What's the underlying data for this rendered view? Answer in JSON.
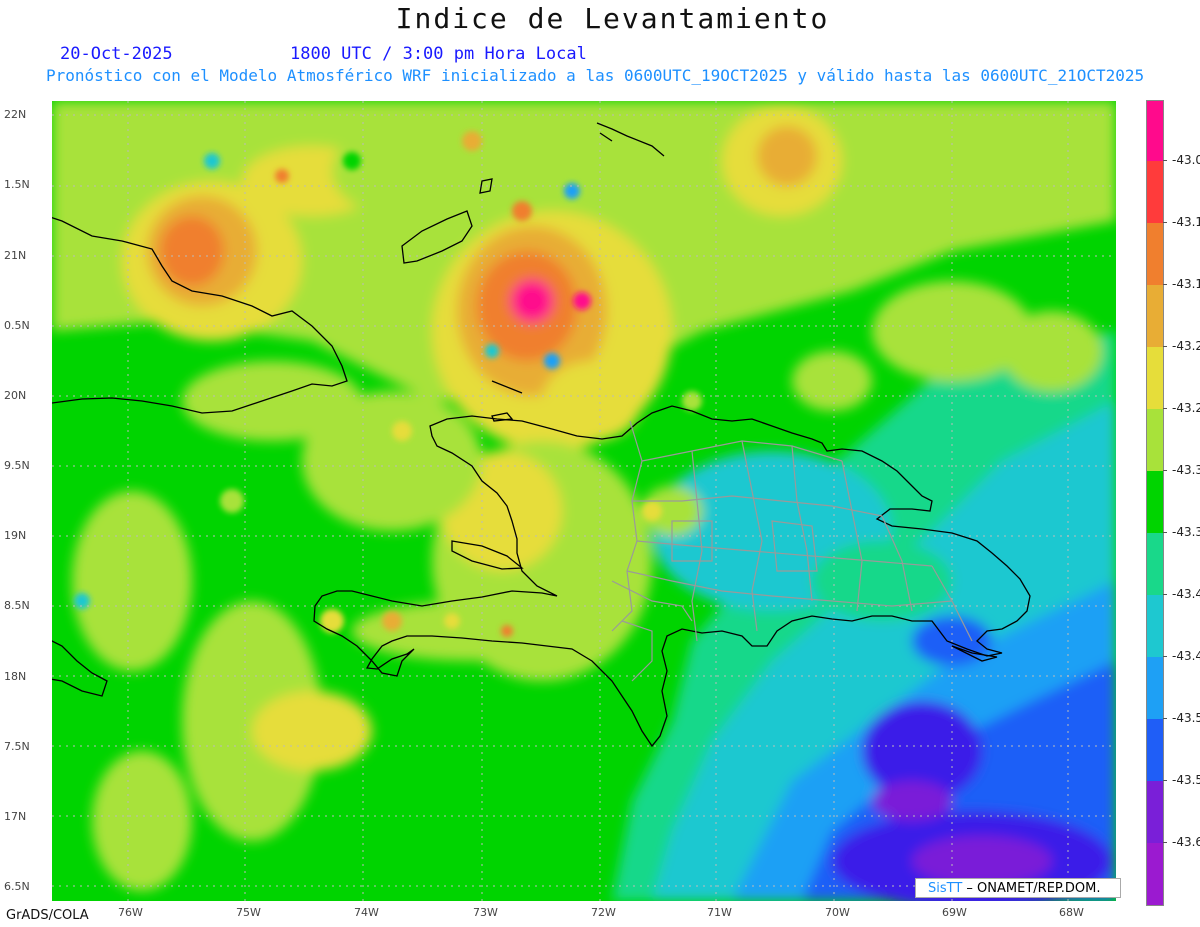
{
  "title": "Indice de Levantamiento",
  "subtitle": {
    "date": "20-Oct-2025",
    "time": "1800 UTC / 3:00 pm Hora Local",
    "model_line": "Pronóstico con el Modelo Atmosférico WRF inicializado a las 0600UTC_19OCT2025 y válido hasta las  0600UTC_21OCT2025"
  },
  "map": {
    "lat_labels": [
      "22N",
      "1.5N",
      "21N",
      "0.5N",
      "20N",
      "9.5N",
      "19N",
      "8.5N",
      "18N",
      "7.5N",
      "17N",
      "6.5N"
    ],
    "lon_labels": [
      "76W",
      "75W",
      "74W",
      "73W",
      "72W",
      "71W",
      "70W",
      "69W",
      "68W"
    ],
    "grid_lines": "dotted"
  },
  "colorbar": {
    "labels": [
      "-43.0",
      "-43.1",
      "-43.1",
      "-43.2",
      "-43.2",
      "-43.3",
      "-43.3",
      "-43.4",
      "-43.4",
      "-43.5",
      "-43.5",
      "-43.6"
    ],
    "colors": [
      "#ff0a8c",
      "#ff3b3b",
      "#f07f2e",
      "#e8ad35",
      "#e6dd3a",
      "#a8e23a",
      "#00d400",
      "#19d88a",
      "#1ec8d0",
      "#1ea0f5",
      "#1f5ef7",
      "#3a1fe8",
      "#7a1fd8",
      "#9b1ad0"
    ]
  },
  "credit": {
    "logo_text": "SisTT",
    "org": " – ONAMET/REP.DOM."
  },
  "footer": "GrADS/COLA"
}
